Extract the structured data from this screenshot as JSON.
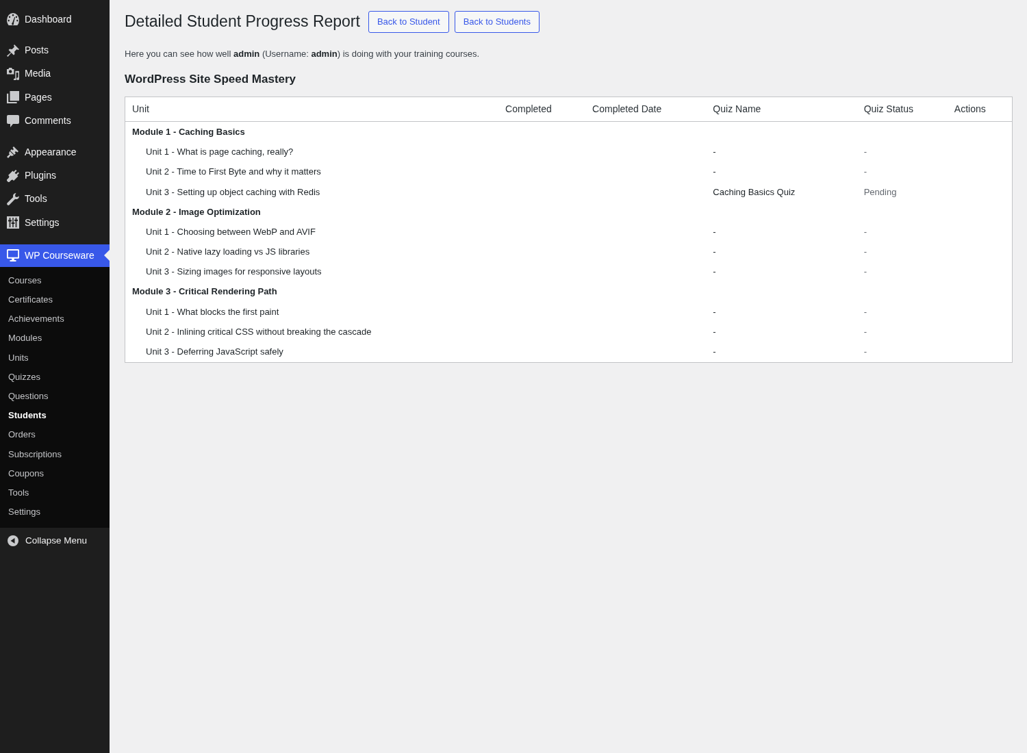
{
  "sidebar": {
    "sections": [
      {
        "items": [
          {
            "label": "Dashboard",
            "selected": false
          }
        ]
      },
      {
        "items": [
          {
            "label": "Posts",
            "selected": false
          },
          {
            "label": "Media",
            "selected": false
          },
          {
            "label": "Pages",
            "selected": false
          },
          {
            "label": "Comments",
            "selected": false
          }
        ]
      },
      {
        "items": [
          {
            "label": "Appearance",
            "selected": false
          },
          {
            "label": "Plugins",
            "selected": false
          },
          {
            "label": "Tools",
            "selected": false
          },
          {
            "label": "Settings",
            "selected": false
          }
        ]
      },
      {
        "items": [
          {
            "label": "WP Courseware",
            "selected": true,
            "children": [
              {
                "label": "Courses",
                "selected": false
              },
              {
                "label": "Certificates",
                "selected": false
              },
              {
                "label": "Achievements",
                "selected": false
              },
              {
                "label": "Modules",
                "selected": false
              },
              {
                "label": "Units",
                "selected": false
              },
              {
                "label": "Quizzes",
                "selected": false
              },
              {
                "label": "Questions",
                "selected": false
              },
              {
                "label": "Students",
                "selected": true
              },
              {
                "label": "Orders",
                "selected": false
              },
              {
                "label": "Subscriptions",
                "selected": false
              },
              {
                "label": "Coupons",
                "selected": false
              },
              {
                "label": "Tools",
                "selected": false
              },
              {
                "label": "Settings",
                "selected": false
              }
            ]
          }
        ]
      }
    ],
    "collapse": {
      "label": "Collapse Menu"
    }
  },
  "page": {
    "title": "Detailed Student Progress Report",
    "buttons": [
      "Back to Student",
      "Back to Students"
    ],
    "intro": "Here you can see how well **admin** (Username: **admin**) is doing with your training courses.",
    "course_title": "WordPress Site Speed Mastery"
  },
  "table": {
    "columns": [
      "Unit",
      "Completed",
      "Completed Date",
      "Quiz Name",
      "Quiz Status",
      "Actions"
    ],
    "rows": [
      {
        "title": "Module 1 - Caching Basics",
        "children": [
          {
            "unit": "Unit 1 - What is page caching, really?",
            "quiz_name": "-",
            "quiz_status": "-"
          },
          {
            "unit": "Unit 2 - Time to First Byte and why it matters",
            "quiz_name": "-",
            "quiz_status": "-"
          },
          {
            "unit": "Unit 3 - Setting up object caching with Redis",
            "quiz_name": "Caching Basics Quiz",
            "quiz_status": "Pending"
          }
        ]
      },
      {
        "title": "Module 2 - Image Optimization",
        "children": [
          {
            "unit": "Unit 1 - Choosing between WebP and AVIF",
            "quiz_name": "-",
            "quiz_status": "-"
          },
          {
            "unit": "Unit 2 - Native lazy loading vs JS libraries",
            "quiz_name": "-",
            "quiz_status": "-"
          },
          {
            "unit": "Unit 3 - Sizing images for responsive layouts",
            "quiz_name": "-",
            "quiz_status": "-"
          }
        ]
      },
      {
        "title": "Module 3 - Critical Rendering Path",
        "children": [
          {
            "unit": "Unit 1 - What blocks the first paint",
            "quiz_name": "-",
            "quiz_status": "-"
          },
          {
            "unit": "Unit 2 - Inlining critical CSS without breaking the cascade",
            "quiz_name": "-",
            "quiz_status": "-"
          },
          {
            "unit": "Unit 3 - Deferring JavaScript safely",
            "quiz_name": "-",
            "quiz_status": "-"
          }
        ]
      }
    ]
  }
}
